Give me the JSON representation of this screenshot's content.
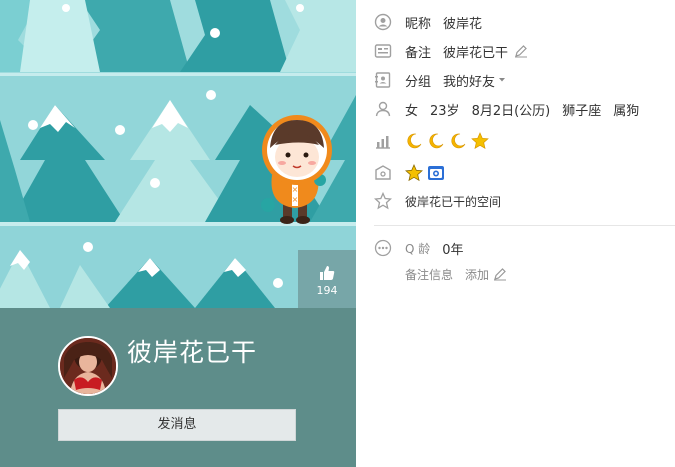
{
  "cover": {
    "like_count": "194"
  },
  "profile": {
    "display_name": "彼岸花已干",
    "send_message_label": "发消息"
  },
  "info": {
    "nickname_label": "昵称",
    "nickname_value": "彼岸花",
    "remark_label": "备注",
    "remark_value": "彼岸花已干",
    "group_label": "分组",
    "group_value": "我的好友",
    "gender": "女",
    "age": "23岁",
    "birthday": "8月2日(公历)",
    "zodiac": "狮子座",
    "chinese_zodiac": "属狗",
    "level_icons": [
      "moon-icon",
      "moon-icon",
      "moon-icon",
      "star-icon"
    ],
    "service_icons": [
      "star-badge-icon",
      "camera-badge-icon"
    ],
    "space_link": "彼岸花已干的空间",
    "qq_age_label": "Q 龄",
    "qq_age_value": "0年",
    "remark_info_label": "备注信息",
    "add_label": "添加"
  },
  "colors": {
    "sky": "#9ddadd",
    "tree_dark": "#2f9ea3",
    "tree_light": "#b5e6e4",
    "card_bg": "#5e8d8a",
    "icon_gray": "#a0a0a0",
    "moon": "#f5b400",
    "link": "#333333"
  }
}
